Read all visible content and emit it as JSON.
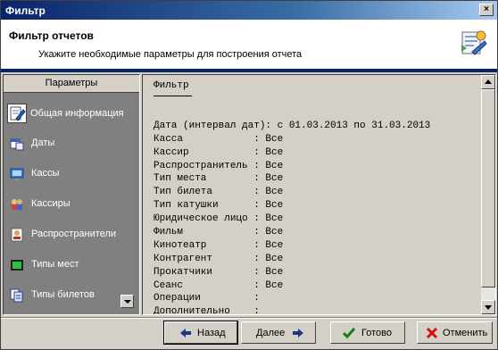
{
  "window": {
    "title": "Фильтр"
  },
  "header": {
    "title": "Фильтр отчетов",
    "subtitle": "Укажите необходимые параметры для построения отчета"
  },
  "sidebar": {
    "heading": "Параметры",
    "items": [
      {
        "label": "Общая информация",
        "icon": "edit-document-icon",
        "active": true
      },
      {
        "label": "Даты",
        "icon": "calendar-icon"
      },
      {
        "label": "Кассы",
        "icon": "computer-icon"
      },
      {
        "label": "Кассиры",
        "icon": "users-icon"
      },
      {
        "label": "Распространители",
        "icon": "contact-card-icon"
      },
      {
        "label": "Типы мест",
        "icon": "seat-type-icon"
      },
      {
        "label": "Типы билетов",
        "icon": "tickets-icon"
      }
    ]
  },
  "report": {
    "tab": "Фильтр",
    "rows": [
      "Дата (интервал дат): с 01.03.2013 по 31.03.2013",
      "Касса            : Все",
      "Кассир           : Все",
      "Распространитель : Все",
      "Тип места        : Все",
      "Тип билета       : Все",
      "Тип катушки      : Все",
      "Юридическое лицо : Все",
      "Фильм            : Все",
      "Кинотеатр        : Все",
      "Контрагент       : Все",
      "Прокатчики       : Все",
      "Сеанс            : Все",
      "Операции         :",
      "Дополнительно    :"
    ]
  },
  "buttons": {
    "back": "Назад",
    "next": "Далее",
    "done": "Готово",
    "cancel": "Отменить"
  },
  "colors": {
    "title_bar": "#0a246a",
    "accent_line": "#0a246a",
    "sidebar_bg": "#808080",
    "face": "#d4d0c8"
  }
}
